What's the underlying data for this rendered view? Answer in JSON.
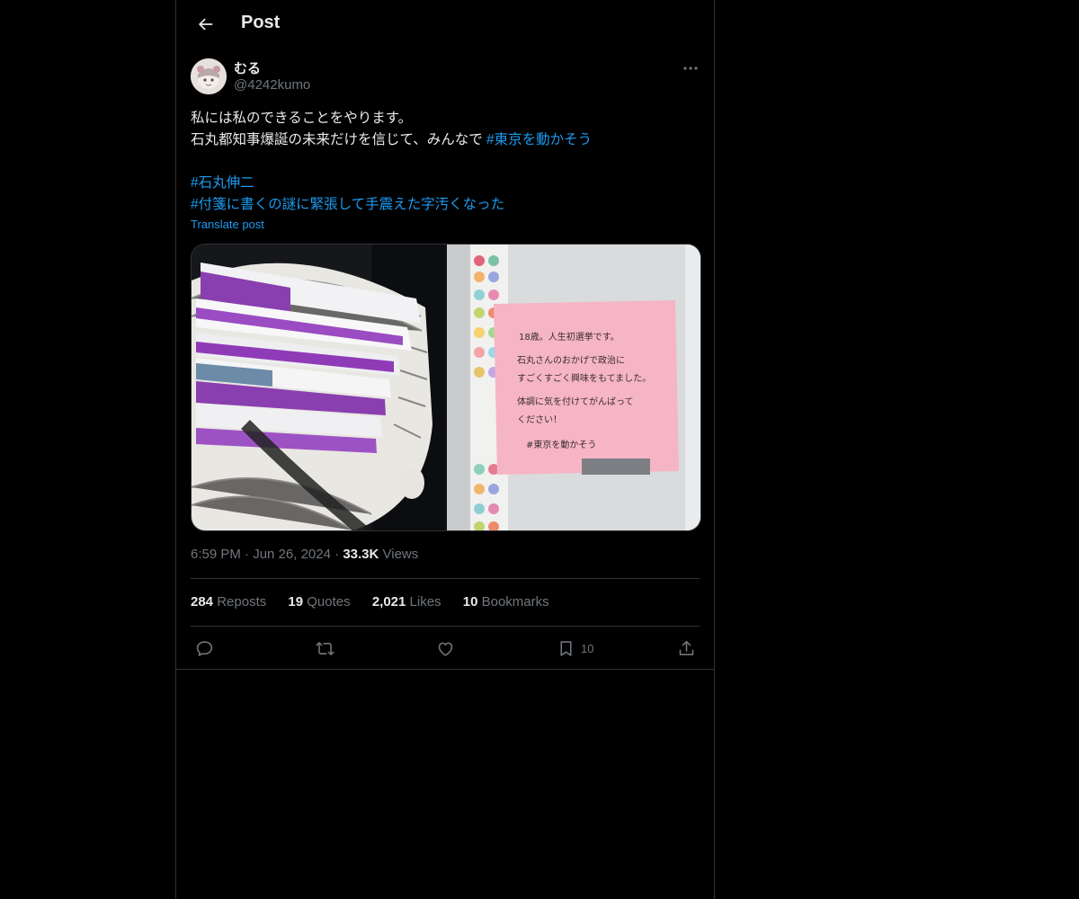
{
  "header": {
    "title": "Post",
    "back_icon": "arrow-left-icon"
  },
  "author": {
    "display_name": "むる",
    "handle": "@4242kumo",
    "avatar_icon": "avatar-illustration"
  },
  "post": {
    "line1": "私には私のできることをやります。",
    "line2_text": "石丸都知事爆誕の未来だけを信じて、みんなで ",
    "line2_hashtag": "#東京を動かそう",
    "hashtag2": "#石丸伸二",
    "hashtag3": "#付箋に書くの謎に緊張して手震えた字汚くなった",
    "translate_label": "Translate post"
  },
  "media": {
    "left_photo": "bag-of-leaflets-photo",
    "right_photo": "sticky-note-photo",
    "note_lines": [
      "18歳。人生初選挙です。",
      "石丸さんのおかげで政治に",
      "すごくすごく興味をもてました。",
      "体調に気を付けてがんばって",
      "ください！",
      "#東京を動かそう"
    ]
  },
  "meta": {
    "time": "6:59 PM",
    "sep1": "·",
    "date": "Jun 26, 2024",
    "sep2": "·",
    "views_count": "33.3K",
    "views_label": "Views"
  },
  "stats": {
    "reposts_count": "284",
    "reposts_label": "Reposts",
    "quotes_count": "19",
    "quotes_label": "Quotes",
    "likes_count": "2,021",
    "likes_label": "Likes",
    "bookmarks_count": "10",
    "bookmarks_label": "Bookmarks"
  },
  "actions": {
    "reply_icon": "reply-icon",
    "repost_icon": "repost-icon",
    "like_icon": "heart-icon",
    "bookmark_icon": "bookmark-icon",
    "bookmark_count": "10",
    "share_icon": "share-icon"
  },
  "colors": {
    "background": "#000000",
    "text": "#e7e9ea",
    "muted": "#71767b",
    "link": "#1d9bf0",
    "border": "#2f3336",
    "note_pink": "#f5b3c4"
  }
}
